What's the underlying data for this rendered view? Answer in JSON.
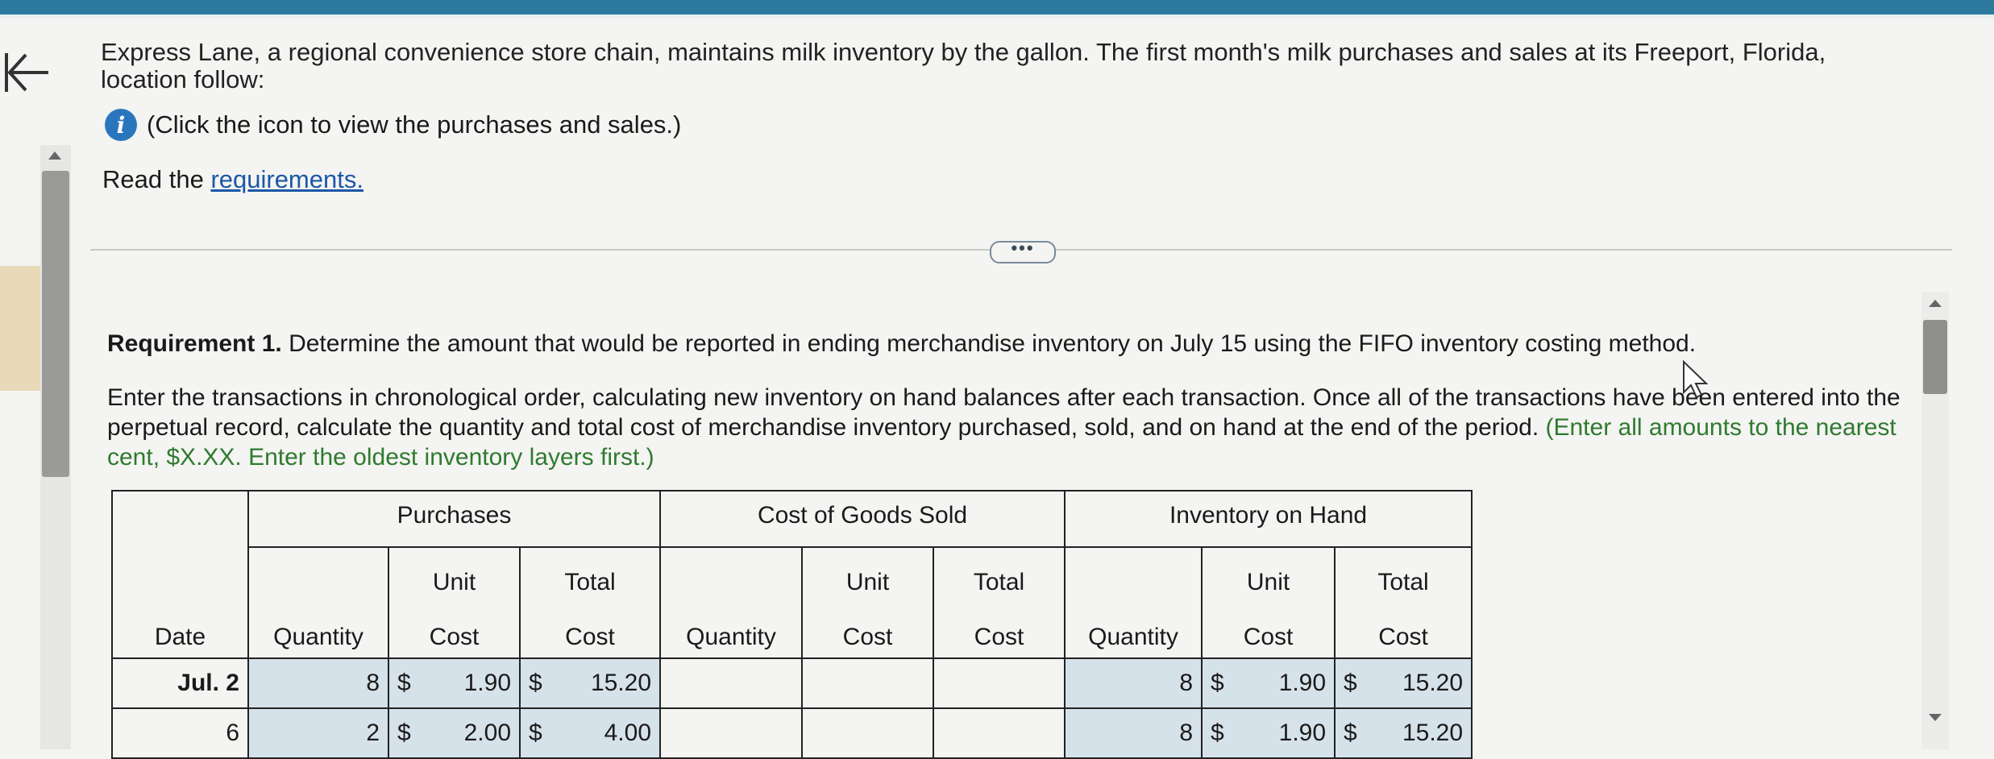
{
  "intro_text": "Express Lane, a regional convenience store chain, maintains milk inventory by the gallon. The first month's milk purchases and sales at its Freeport, Florida, location follow:",
  "info_text": "(Click the icon to view the purchases and sales.)",
  "info_icon_glyph": "i",
  "read_prefix": "Read the ",
  "read_link": "requirements.",
  "more_button": "•••",
  "requirement": {
    "title_bold": "Requirement 1.",
    "title_rest": " Determine the amount that would be reported in ending merchandise inventory on July 15 using the FIFO inventory costing method.",
    "body_main": "Enter the transactions in chronological order, calculating new inventory on hand balances after each transaction. Once all of the transactions have been entered into the perpetual record, calculate the quantity and total cost of merchandise inventory purchased, sold, and on hand at the end of the period. ",
    "body_green": "(Enter all amounts to the nearest cent, $X.XX. Enter the oldest inventory layers first.)"
  },
  "table": {
    "group_headers": {
      "purchases": "Purchases",
      "cogs": "Cost of Goods Sold",
      "inventory": "Inventory on Hand"
    },
    "sub_headers": {
      "unit": "Unit",
      "total": "Total",
      "cost": "Cost",
      "quantity": "Quantity",
      "date": "Date"
    },
    "rows": [
      {
        "date": "Jul. 2",
        "purchase_qty": "8",
        "purchase_unit_sign": "$",
        "purchase_unit": "1.90",
        "purchase_total_sign": "$",
        "purchase_total": "15.20",
        "inv_qty": "8",
        "inv_unit_sign": "$",
        "inv_unit": "1.90",
        "inv_total_sign": "$",
        "inv_total": "15.20"
      },
      {
        "date": "6",
        "purchase_qty": "2",
        "purchase_unit_sign": "$",
        "purchase_unit": "2.00",
        "purchase_total_sign": "$",
        "purchase_total": "4.00",
        "inv_qty": "8",
        "inv_unit_sign": "$",
        "inv_unit": "1.90",
        "inv_total_sign": "$",
        "inv_total": "15.20"
      }
    ]
  }
}
